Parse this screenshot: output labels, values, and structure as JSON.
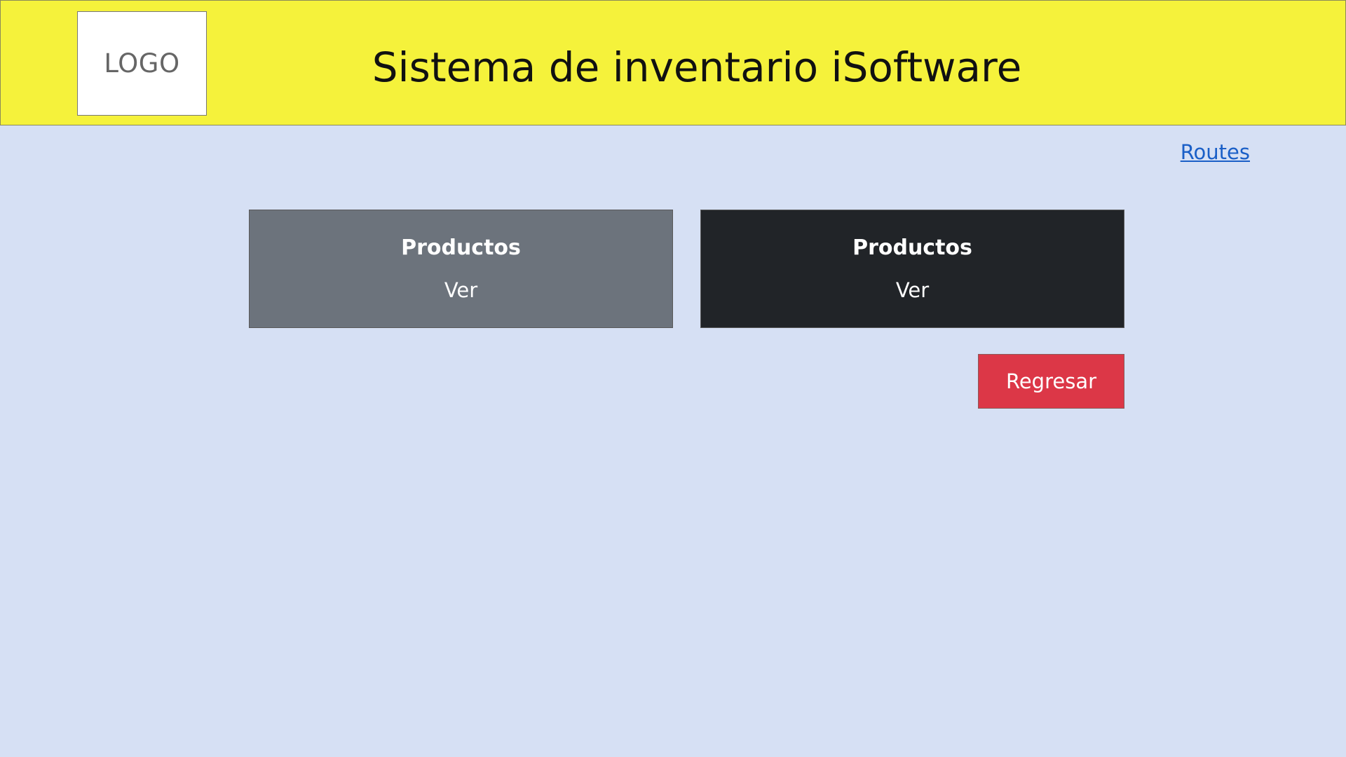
{
  "header": {
    "logo_text": "LOGO",
    "title": "Sistema de inventario iSoftware",
    "background_color": "#f5f23b"
  },
  "nav": {
    "routes_link": "Routes"
  },
  "cards": [
    {
      "title": "Productos",
      "action": "Ver",
      "color": "#6c737c"
    },
    {
      "title": "Productos",
      "action": "Ver",
      "color": "#212428"
    }
  ],
  "actions": {
    "back_label": "Regresar",
    "back_color": "#dc3747"
  },
  "page": {
    "background_color": "#d6e0f4"
  }
}
